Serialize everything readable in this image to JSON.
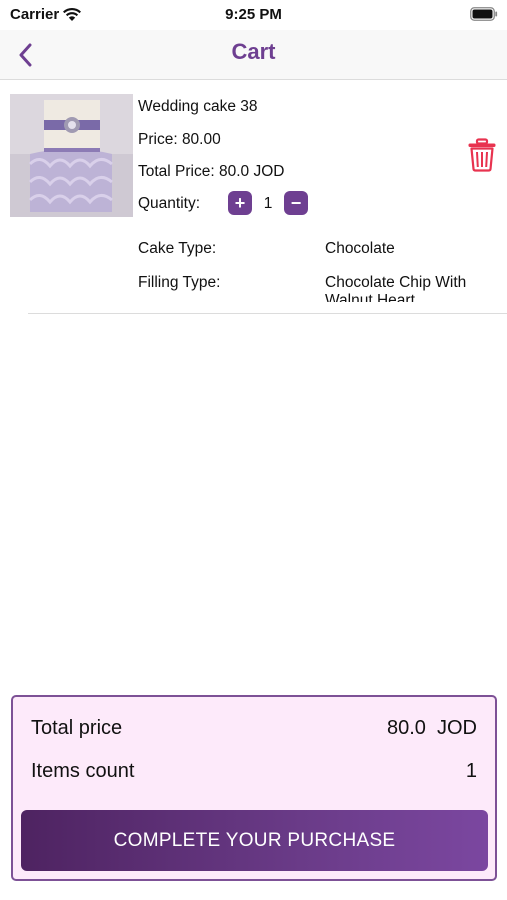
{
  "status_bar": {
    "carrier": "Carrier",
    "time": "9:25 PM",
    "icons": [
      "wifi-icon",
      "battery-icon"
    ]
  },
  "nav": {
    "title": "Cart",
    "back_icon": "chevron-left-icon"
  },
  "cart_items": [
    {
      "name": "Wedding cake 38",
      "price_label": "Price:",
      "price": "80.00",
      "total_label": "Total Price:",
      "total": "80.0 JOD",
      "quantity_label": "Quantity:",
      "quantity": "1",
      "plus": "+",
      "minus": "−",
      "image": "wedding-cake-image",
      "delete_icon": "trash-icon",
      "specs": [
        {
          "label": "Cake Type:",
          "value": "Chocolate"
        },
        {
          "label": "Filling Type:",
          "value": "Chocolate Chip With Walnut Heart"
        }
      ]
    }
  ],
  "summary": {
    "total_label": "Total price",
    "total_value": "80.0  JOD",
    "count_label": "Items count",
    "count_value": "1",
    "button_label": "COMPLETE YOUR PURCHASE"
  },
  "colors": {
    "accent": "#6e3f91",
    "summary_bg": "#fdeafa",
    "summary_border": "#7d5196",
    "delete": "#e8334f"
  }
}
